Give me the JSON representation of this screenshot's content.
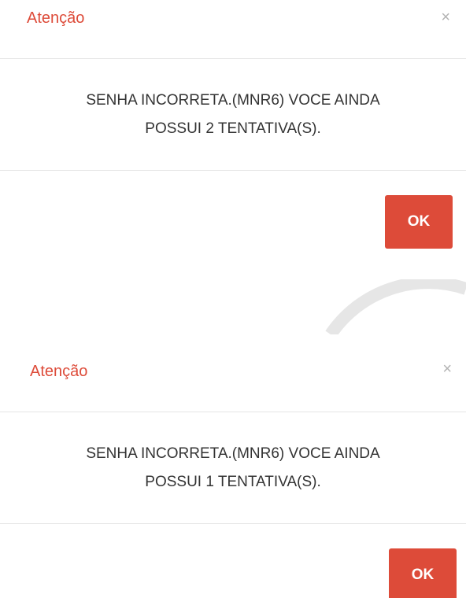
{
  "dialogs": [
    {
      "title": "Atenção",
      "close_glyph": "×",
      "message_line1": "SENHA INCORRETA.(MNR6) VOCE AINDA",
      "message_line2": "POSSUI 2 TENTATIVA(S).",
      "ok_label": "OK"
    },
    {
      "title": "Atenção",
      "close_glyph": "×",
      "message_line1": "SENHA INCORRETA.(MNR6) VOCE AINDA",
      "message_line2": "POSSUI 1 TENTATIVA(S).",
      "ok_label": "OK"
    }
  ],
  "colors": {
    "accent": "#dd4b39",
    "text": "#333333",
    "close": "#b3b3b3",
    "divider": "#e5e5e5",
    "spinner": "#e6e6e6"
  },
  "icons": {
    "close": "close-icon",
    "spinner": "loading-spinner-icon"
  }
}
